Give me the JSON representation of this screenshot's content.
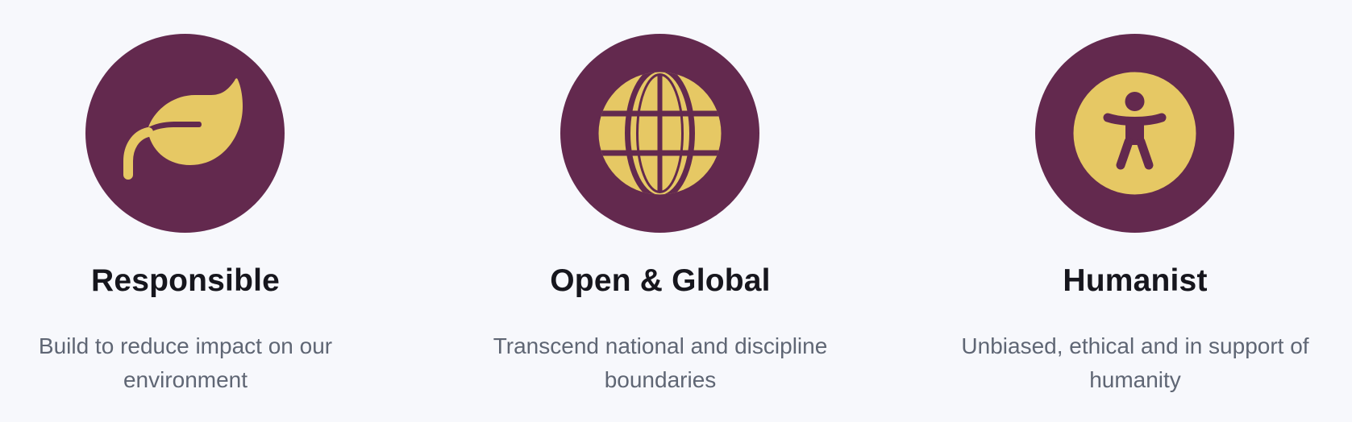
{
  "colors": {
    "background": "#f7f8fc",
    "circle": "#63294e",
    "icon": "#e6c864",
    "title": "#16161d",
    "description": "#5f6674"
  },
  "features": [
    {
      "icon": "leaf-icon",
      "title": "Responsible",
      "description": "Build to reduce impact on our environment"
    },
    {
      "icon": "globe-icon",
      "title": "Open & Global",
      "description": "Transcend national and discipline boundaries"
    },
    {
      "icon": "accessibility-icon",
      "title": "Humanist",
      "description": "Unbiased, ethical and in support of humanity"
    }
  ]
}
